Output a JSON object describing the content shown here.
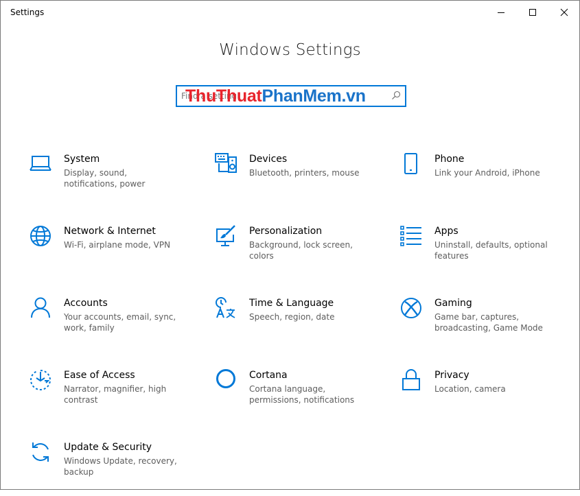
{
  "window": {
    "title": "Settings",
    "controls": [
      "minimize",
      "maximize",
      "close"
    ]
  },
  "header": {
    "title": "Windows Settings"
  },
  "search": {
    "value": "",
    "placeholder": "Find a setting",
    "watermark_part1": "ThuThuat",
    "watermark_part2": "PhanMem.vn"
  },
  "colors": {
    "accent": "#0078d7",
    "watermark_red": "#e8242c",
    "watermark_blue": "#1a73c9"
  },
  "categories": [
    {
      "title": "System",
      "description": "Display, sound, notifications, power",
      "icon": "laptop-icon"
    },
    {
      "title": "Devices",
      "description": "Bluetooth, printers, mouse",
      "icon": "keyboard-speaker-icon"
    },
    {
      "title": "Phone",
      "description": "Link your Android, iPhone",
      "icon": "phone-icon"
    },
    {
      "title": "Network & Internet",
      "description": "Wi-Fi, airplane mode, VPN",
      "icon": "globe-icon"
    },
    {
      "title": "Personalization",
      "description": "Background, lock screen, colors",
      "icon": "paint-screen-icon"
    },
    {
      "title": "Apps",
      "description": "Uninstall, defaults, optional features",
      "icon": "apps-list-icon"
    },
    {
      "title": "Accounts",
      "description": "Your accounts, email, sync, work, family",
      "icon": "person-icon"
    },
    {
      "title": "Time & Language",
      "description": "Speech, region, date",
      "icon": "time-language-icon"
    },
    {
      "title": "Gaming",
      "description": "Game bar, captures, broadcasting, Game Mode",
      "icon": "xbox-icon"
    },
    {
      "title": "Ease of Access",
      "description": "Narrator, magnifier, high contrast",
      "icon": "ease-of-access-icon"
    },
    {
      "title": "Cortana",
      "description": "Cortana language, permissions, notifications",
      "icon": "cortana-icon"
    },
    {
      "title": "Privacy",
      "description": "Location, camera",
      "icon": "lock-icon"
    },
    {
      "title": "Update & Security",
      "description": "Windows Update, recovery, backup",
      "icon": "sync-icon"
    }
  ]
}
